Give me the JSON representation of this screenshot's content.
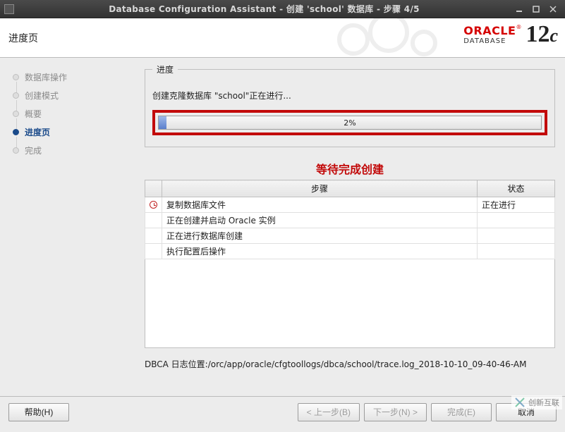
{
  "window": {
    "title": "Database Configuration Assistant - 创建  'school' 数据库  -  步骤  4/5"
  },
  "header": {
    "page_title": "进度页",
    "brand_primary": "ORACLE",
    "brand_secondary": "DATABASE",
    "brand_version_num": "12",
    "brand_version_suffix": "c"
  },
  "sidebar": {
    "steps": [
      {
        "label": "数据库操作",
        "active": false
      },
      {
        "label": "创建模式",
        "active": false
      },
      {
        "label": "概要",
        "active": false
      },
      {
        "label": "进度页",
        "active": true
      },
      {
        "label": "完成",
        "active": false
      }
    ]
  },
  "progress": {
    "legend": "进度",
    "info_line": "创建克隆数据库 \"school\"正在进行...",
    "percent_label": "2%",
    "percent_value": 2
  },
  "annotation": {
    "wait_note": "等待完成创建"
  },
  "table": {
    "header_step": "步骤",
    "header_status": "状态",
    "rows": [
      {
        "icon": "clock",
        "step": "复制数据库文件",
        "status": "正在进行"
      },
      {
        "icon": "",
        "step": "正在创建并启动 Oracle 实例",
        "status": ""
      },
      {
        "icon": "",
        "step": "正在进行数据库创建",
        "status": ""
      },
      {
        "icon": "",
        "step": "执行配置后操作",
        "status": ""
      }
    ]
  },
  "log": {
    "prefix": "DBCA 日志位置:",
    "path": "/orc/app/oracle/cfgtoollogs/dbca/school/trace.log_2018-10-10_09-40-46-AM"
  },
  "footer": {
    "help": "帮助(H)",
    "back": "< 上一步(B)",
    "next": "下一步(N) >",
    "finish": "完成(E)",
    "cancel": "取消"
  },
  "watermark": {
    "text": "创新互联"
  }
}
